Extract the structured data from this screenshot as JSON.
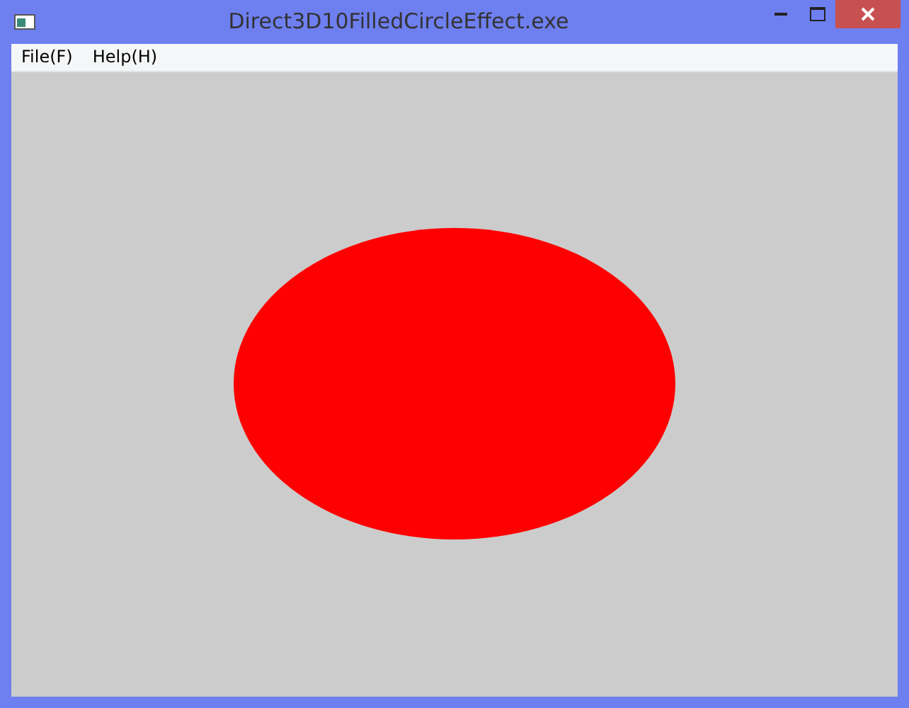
{
  "window": {
    "title": "Direct3D10FilledCircleEffect.exe"
  },
  "menu": [
    {
      "label": "File(F)"
    },
    {
      "label": "Help(H)"
    }
  ]
}
